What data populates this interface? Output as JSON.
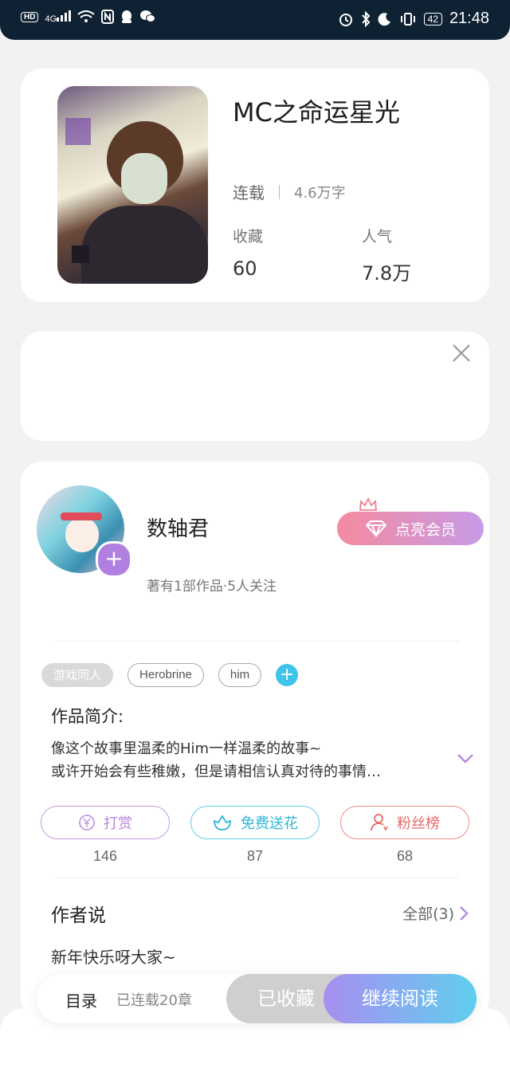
{
  "status_bar": {
    "left_icons": [
      "hd-icon",
      "signal-4g-icon",
      "wifi-icon",
      "nfc-icon",
      "qq-icon",
      "wechat-icon"
    ],
    "hd": "HD",
    "net": "4G",
    "right_icons": [
      "alarm-icon",
      "bluetooth-icon",
      "moon-icon",
      "vibrate-icon",
      "battery-icon"
    ],
    "battery": "42",
    "time": "21:48"
  },
  "book": {
    "title": "MC之命运星光",
    "status": "连载",
    "word_count": "4.6万字",
    "favorites_label": "收藏",
    "favorites_value": "60",
    "popularity_label": "人气",
    "popularity_value": "7.8万"
  },
  "author": {
    "name": "数轴君",
    "meta": "著有1部作品·5人关注",
    "vip_button": "点亮会员",
    "tags": [
      "游戏同人",
      "Herobrine",
      "him"
    ],
    "intro_title": "作品简介:",
    "intro_line1": "像这个故事里温柔的Him一样温柔的故事~",
    "intro_line2": "或许开始会有些稚嫩，但是请相信认真对待的事情…"
  },
  "actions": {
    "reward_label": "打赏",
    "reward_count": "146",
    "flower_label": "免费送花",
    "flower_count": "87",
    "fans_label": "粉丝榜",
    "fans_count": "68"
  },
  "author_says": {
    "title": "作者说",
    "all_label": "全部(3)",
    "latest": "新年快乐呀大家~"
  },
  "bottom_bar": {
    "toc_label": "目录",
    "chapters": "已连载20章",
    "favorited": "已收藏",
    "continue": "继续阅读"
  },
  "colors": {
    "vip_gradient": [
      "#f48aa0",
      "#c79be6"
    ],
    "read_gradient": [
      "#a88ef1",
      "#5fcfee"
    ],
    "tag_add": "#3ec3ea",
    "avatar_plus": "#b17fe0"
  }
}
